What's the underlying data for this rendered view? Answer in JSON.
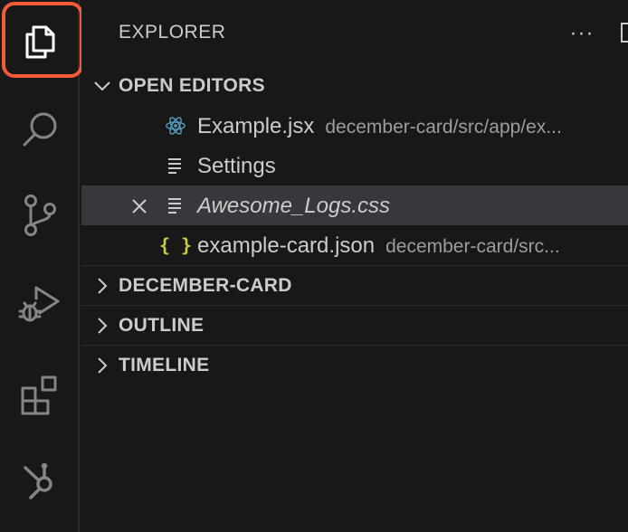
{
  "activity_bar": {
    "items": [
      {
        "name": "explorer-icon",
        "active": true
      },
      {
        "name": "search-icon",
        "active": false
      },
      {
        "name": "source-control-icon",
        "active": false
      },
      {
        "name": "run-and-debug-icon",
        "active": false
      },
      {
        "name": "extensions-icon",
        "active": false
      },
      {
        "name": "hubspot-icon",
        "active": false
      }
    ],
    "highlight_color": "#f25b37"
  },
  "explorer": {
    "title": "EXPLORER",
    "more_actions": "···"
  },
  "open_editors": {
    "label": "OPEN EDITORS",
    "expanded": true,
    "files": [
      {
        "name": "Example.jsx",
        "description": "december-card/src/app/ex...",
        "icon": "react-icon",
        "icon_color": "#519aba",
        "active": false,
        "italic": false
      },
      {
        "name": "Settings",
        "description": "",
        "icon": "lines-file-icon",
        "active": false,
        "italic": false
      },
      {
        "name": "Awesome_Logs.css",
        "description": "",
        "icon": "lines-file-icon",
        "active": true,
        "italic": true,
        "close": "×"
      },
      {
        "name": "example-card.json",
        "description": "december-card/src...",
        "icon": "json-braces-icon",
        "icon_glyph": "{ }",
        "icon_color": "#cbcb41",
        "active": false,
        "italic": false
      }
    ]
  },
  "sections": [
    {
      "label": "DECEMBER-CARD",
      "expanded": false
    },
    {
      "label": "OUTLINE",
      "expanded": false
    },
    {
      "label": "TIMELINE",
      "expanded": false
    }
  ]
}
